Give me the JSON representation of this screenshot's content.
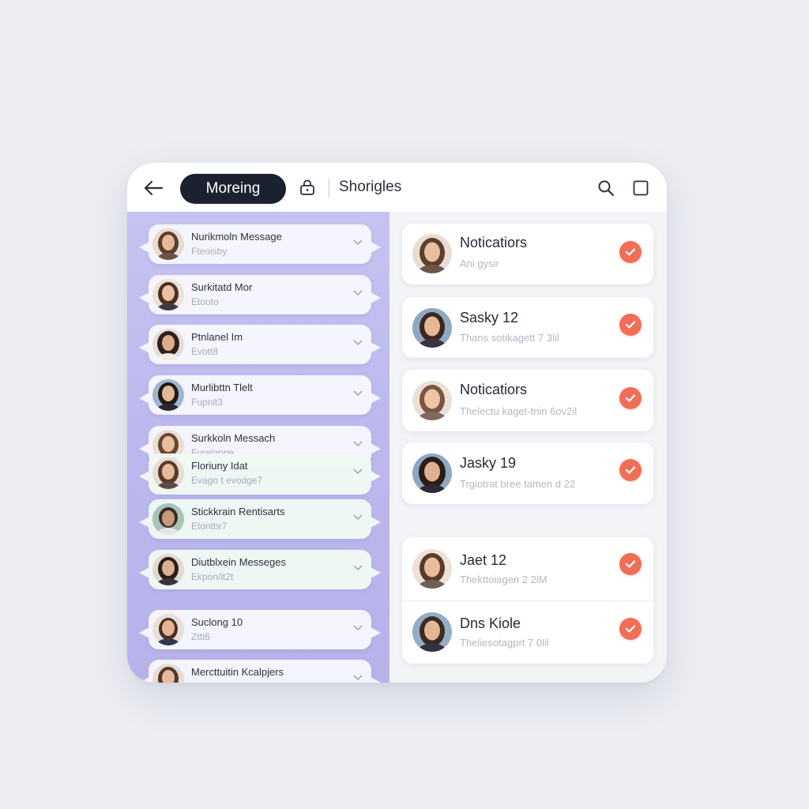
{
  "header": {
    "back_icon": "arrow-left-icon",
    "pill_label": "Moreing",
    "lock_icon": "lock-icon",
    "title": "Shorigles",
    "search_icon": "search-icon",
    "square_icon": "square-icon"
  },
  "colors": {
    "left_panel": "#bdb9ee",
    "pill": "#1c2130",
    "check": "#f06e56"
  },
  "messages": [
    {
      "name": "Nurikmoln Message",
      "sub": "Fteoisby"
    },
    {
      "name": "Surkitatd Mor",
      "sub": "Etooto"
    },
    {
      "name": "Ptnlanel Im",
      "sub": "Evott8"
    },
    {
      "name": "Murlibttn Tlelt",
      "sub": "Fupnit3"
    },
    {
      "name": "Surkkoln Messach",
      "sub": "Fureinppe"
    },
    {
      "name": "Floriuny Idat",
      "sub": "Evago t evodge7"
    },
    {
      "name": "Stickkrain Rentisarts",
      "sub": "Etontbr7"
    },
    {
      "name": "Diutblxein Messeges",
      "sub": "Ekpon/it2t"
    },
    {
      "name": "Suclong 10",
      "sub": "Zttt6"
    },
    {
      "name": "Mercttuitin Kcalpjers",
      "sub": ""
    }
  ],
  "notifications": [
    {
      "title": "Noticatiors",
      "sub": "Ani gysir"
    },
    {
      "title": "Sasky 12",
      "sub": "Thans sotikagett 7 3lil"
    },
    {
      "title": "Noticatiors",
      "sub": "Thelectu kaget-tnin 6ov2il"
    },
    {
      "title": "Jasky 19",
      "sub": "Trgiotrat bree tamen d 22"
    },
    {
      "title": "Jaet 12",
      "sub": "Thekttoiagen 2 2lM"
    },
    {
      "title": "Dns Kiole",
      "sub": "Theliesotagprt 7 0lil"
    }
  ]
}
